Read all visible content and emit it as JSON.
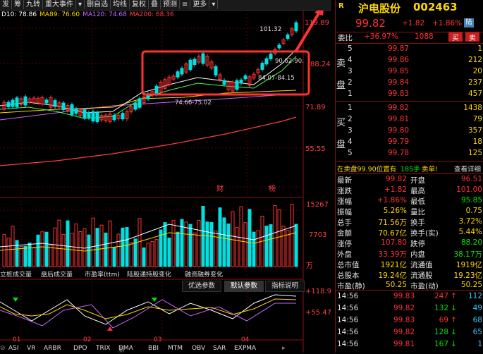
{
  "toolbar": [
    "发",
    "筹",
    "九转",
    "重大事件",
    "▾",
    "删自选",
    "均线",
    "复权",
    "叠",
    "预测",
    "≡",
    "更多",
    "▾"
  ],
  "ma": [
    {
      "label": "D10: 78.86",
      "color": "#ffffff"
    },
    {
      "label": "MA89: 76.60",
      "color": "#ffd700"
    },
    {
      "label": "MA120: 74.68",
      "color": "#c864ff"
    },
    {
      "label": "MA200: 68.36",
      "color": "#ff4040"
    }
  ],
  "price_axis": [
    "119.89",
    "88.24",
    "71.89",
    "55.55"
  ],
  "chart_annotations": {
    "high": "101.32",
    "a1": "90.62-90.",
    "a2": "84.07-84.15",
    "a3": "74.66-75.02",
    "fin": "财",
    "list": "榜"
  },
  "volume_axis": [
    "15267",
    "7703",
    "万"
  ],
  "volume_tabs": [
    "立桩成交量",
    "盘后成交量",
    "市盈率(ttm)",
    "陆股通持股变化",
    "融资融券变化"
  ],
  "param_tabs": [
    "优选参数",
    "默认参数",
    "指标说明"
  ],
  "osc_axis": [
    "+118.9",
    "+55.47"
  ],
  "date_labels": [
    "01",
    "02",
    "03",
    "04"
  ],
  "indicator_tabs": [
    "ASI",
    "VR",
    "ARBR",
    "DPO",
    "TRIX",
    "DMA",
    "BBI",
    "MTM",
    "OBV",
    "SAR",
    "EXPMA"
  ],
  "indicator_extra": [
    "⊘",
    "新",
    "▸"
  ],
  "stock": {
    "badge": "R",
    "name": "沪电股份",
    "code": "002463",
    "price": "99.82",
    "change": "+1.82",
    "pct": "+1.86%",
    "tag": "陆"
  },
  "weibi": {
    "label": "委比",
    "value": "+36.97%",
    "diff": "1088",
    "buy": "买",
    "sell": "卖"
  },
  "sell_levels": [
    {
      "n": "5",
      "price": "99.87",
      "vol": "1"
    },
    {
      "n": "4",
      "price": "99.86",
      "vol": "212"
    },
    {
      "n": "3",
      "price": "99.85",
      "vol": "20"
    },
    {
      "n": "2",
      "price": "99.84",
      "vol": "237"
    },
    {
      "n": "1",
      "price": "99.83",
      "vol": "457"
    }
  ],
  "buy_levels": [
    {
      "n": "1",
      "price": "99.82",
      "vol": "1438"
    },
    {
      "n": "2",
      "price": "99.81",
      "vol": "79"
    },
    {
      "n": "3",
      "price": "99.80",
      "vol": "357"
    },
    {
      "n": "4",
      "price": "99.79",
      "vol": "18"
    },
    {
      "n": "5",
      "price": "99.78",
      "vol": "125"
    }
  ],
  "sell_label": [
    "卖",
    "盘"
  ],
  "buy_label": [
    "买",
    "盘"
  ],
  "notice": {
    "text": "在卖盘99.90位置有",
    "count": "185手",
    "action": "卖单!",
    "link": "查看详细"
  },
  "stats": [
    {
      "l": "最新",
      "lv": "99.82",
      "lc": "red",
      "r": "开盘",
      "rv": "96.51",
      "rc": "red"
    },
    {
      "l": "涨跌",
      "lv": "+1.82",
      "lc": "red",
      "r": "最高",
      "rv": "101.00",
      "rc": "red"
    },
    {
      "l": "涨幅",
      "lv": "+1.86%",
      "lc": "red",
      "r": "最低",
      "rv": "95.85",
      "rc": "green"
    },
    {
      "l": "振幅",
      "lv": "5.26%",
      "lc": "yellow",
      "r": "量比",
      "rv": "0.75",
      "rc": "yellow"
    },
    {
      "l": "总手",
      "lv": "71.56万",
      "lc": "yellow",
      "r": "换手",
      "rv": "3.72%",
      "rc": "yellow"
    },
    {
      "l": "金额",
      "lv": "70.67亿",
      "lc": "yellow",
      "r": "换手(实)",
      "rv": "5.44%",
      "rc": "yellow"
    },
    {
      "l": "涨停",
      "lv": "107.80",
      "lc": "red",
      "r": "跌停",
      "rv": "88.20",
      "rc": "green"
    },
    {
      "l": "外盘",
      "lv": "33.39万",
      "lc": "red",
      "r": "内盘",
      "rv": "38.17万",
      "rc": "green"
    },
    {
      "l": "总市值",
      "lv": "1921亿",
      "lc": "yellow",
      "r": "流通值",
      "rv": "1919亿",
      "rc": "yellow"
    },
    {
      "l": "总股本",
      "lv": "19.24亿",
      "lc": "yellow",
      "r": "流通股",
      "rv": "19.23亿",
      "rc": "yellow"
    },
    {
      "l": "市盈(静)",
      "lv": "50.25",
      "lc": "yellow",
      "r": "市盈(动)",
      "rv": "50.25",
      "rc": "yellow"
    }
  ],
  "ticks": [
    {
      "time": "14:56",
      "price": "99.83",
      "vol": "247",
      "dir": "↑",
      "dc": "red",
      "n": "112"
    },
    {
      "time": "14:56",
      "price": "99.82",
      "vol": "132",
      "dir": "↓",
      "dc": "green",
      "n": "49"
    },
    {
      "time": "14:56",
      "price": "99.83",
      "vol": "69",
      "dir": "↑",
      "dc": "red",
      "n": "68"
    },
    {
      "time": "14:56",
      "price": "99.82",
      "vol": "128",
      "dir": "↓",
      "dc": "green",
      "n": "65"
    },
    {
      "time": "14:56",
      "price": "99.81",
      "vol": "167",
      "dir": "↓",
      "dc": "green",
      "n": "1"
    }
  ]
}
